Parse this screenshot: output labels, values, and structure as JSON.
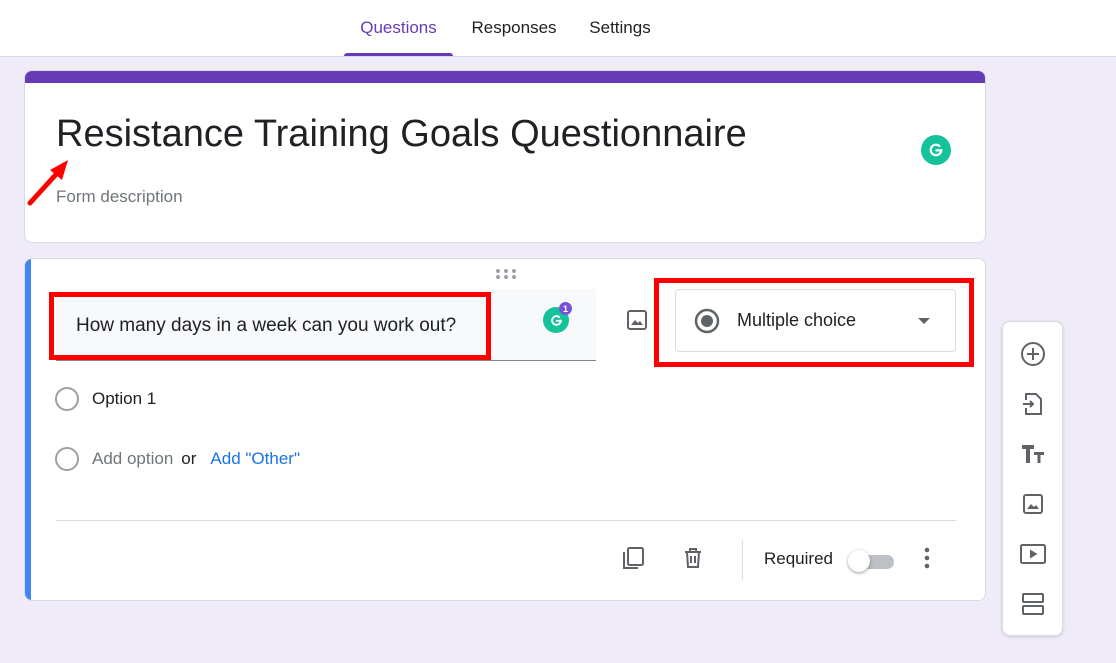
{
  "tabs": [
    {
      "label": "Questions",
      "active": true
    },
    {
      "label": "Responses",
      "active": false
    },
    {
      "label": "Settings",
      "active": false
    }
  ],
  "form": {
    "title": "Resistance Training Goals Questionnaire",
    "description_placeholder": "Form description"
  },
  "question": {
    "text": "How many days in a week can you work out?",
    "type": "Multiple choice",
    "grammarly_count": "1",
    "options": [
      "Option 1"
    ],
    "add_option": "Add option",
    "or": "or",
    "add_other": "Add \"Other\"",
    "required_label": "Required",
    "required": false
  },
  "colors": {
    "theme": "#673ab7",
    "accent": "#4285f4",
    "background": "#f0ebf8",
    "grammarly": "#15c39a",
    "link": "#1a73e8",
    "highlight": "#ff0000"
  },
  "side_toolbar": {
    "icons": [
      "add-question-icon",
      "import-questions-icon",
      "add-title-icon",
      "add-image-icon",
      "add-video-icon",
      "add-section-icon"
    ]
  }
}
